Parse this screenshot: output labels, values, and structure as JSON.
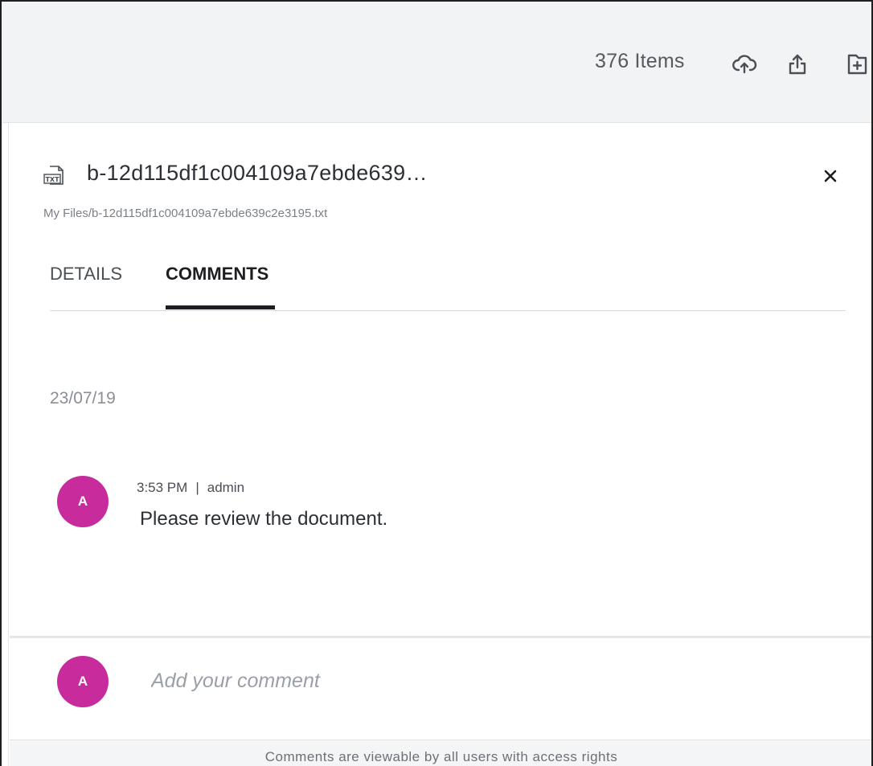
{
  "toolbar": {
    "item_count": "376 Items",
    "icons": [
      "cloud-upload-icon",
      "share-upload-icon",
      "new-folder-icon"
    ]
  },
  "file": {
    "type_icon_label": "TXT",
    "name": "b-12d115df1c004109a7ebde639…",
    "path": "My Files/b-12d115df1c004109a7ebde639c2e3195.txt",
    "close_label": "×"
  },
  "tabs": [
    {
      "label": "DETAILS",
      "active": false
    },
    {
      "label": "COMMENTS",
      "active": true
    }
  ],
  "comments": {
    "date": "23/07/19",
    "items": [
      {
        "avatar_initial": "A",
        "time": "3:53 PM",
        "separator": "|",
        "author": "admin",
        "text": "Please review the document."
      }
    ]
  },
  "composer": {
    "avatar_initial": "A",
    "placeholder": "Add your comment",
    "value": ""
  },
  "footer": {
    "note": "Comments are viewable by all users with access rights"
  },
  "colors": {
    "avatar": "#c72b9c",
    "toolbar_bg": "#f2f3f4",
    "active_tab": "#1c1e21"
  }
}
